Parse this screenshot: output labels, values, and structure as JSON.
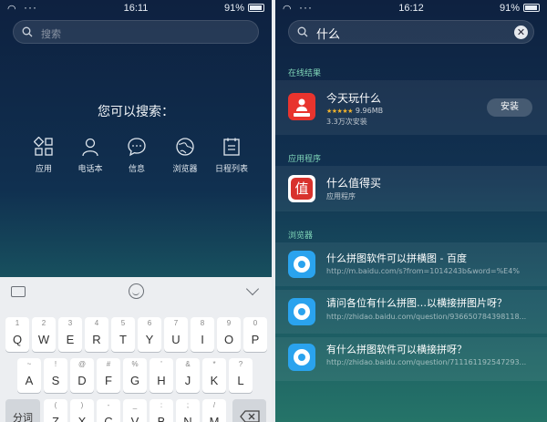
{
  "left": {
    "status": {
      "time": "16:11",
      "battery": "91%"
    },
    "search": {
      "placeholder": "搜索"
    },
    "hint": "您可以搜索：",
    "categories": [
      {
        "label": "应用",
        "icon": "apps-grid-icon"
      },
      {
        "label": "电话本",
        "icon": "contacts-person-icon"
      },
      {
        "label": "信息",
        "icon": "message-bubble-icon"
      },
      {
        "label": "浏览器",
        "icon": "browser-globe-icon"
      },
      {
        "label": "日程列表",
        "icon": "calendar-list-icon"
      }
    ],
    "keyboard": {
      "row1": [
        {
          "num": "1",
          "ch": "Q"
        },
        {
          "num": "2",
          "ch": "W"
        },
        {
          "num": "3",
          "ch": "E"
        },
        {
          "num": "4",
          "ch": "R"
        },
        {
          "num": "5",
          "ch": "T"
        },
        {
          "num": "6",
          "ch": "Y"
        },
        {
          "num": "7",
          "ch": "U"
        },
        {
          "num": "8",
          "ch": "I"
        },
        {
          "num": "9",
          "ch": "O"
        },
        {
          "num": "0",
          "ch": "P"
        }
      ],
      "row2": [
        {
          "num": "~",
          "ch": "A"
        },
        {
          "num": "!",
          "ch": "S"
        },
        {
          "num": "@",
          "ch": "D"
        },
        {
          "num": "#",
          "ch": "F"
        },
        {
          "num": "%",
          "ch": "G"
        },
        {
          "num": "'",
          "ch": "H"
        },
        {
          "num": "&",
          "ch": "J"
        },
        {
          "num": "*",
          "ch": "K"
        },
        {
          "num": "?",
          "ch": "L"
        }
      ],
      "row3": [
        {
          "num": "",
          "ch": "分词"
        },
        {
          "num": "(",
          "ch": "Z"
        },
        {
          "num": ")",
          "ch": "X"
        },
        {
          "num": "-",
          "ch": "C"
        },
        {
          "num": "_",
          "ch": "V"
        },
        {
          "num": ":",
          "ch": "B"
        },
        {
          "num": ";",
          "ch": "N"
        },
        {
          "num": "/",
          "ch": "M"
        }
      ]
    }
  },
  "right": {
    "status": {
      "time": "16:12",
      "battery": "91%"
    },
    "search": {
      "query": "什么"
    },
    "sections": {
      "online": "在线结果",
      "apps": "应用程序",
      "browser": "浏览器"
    },
    "online_result": {
      "title": "今天玩什么",
      "rating_stars": "★★★★★",
      "size": "9.96MB",
      "installs": "3.3万次安装",
      "button": "安装",
      "icon_color": "#e8342e"
    },
    "app_result": {
      "title": "什么值得买",
      "subtitle": "应用程序",
      "icon_color": "#d8322d",
      "icon_char": "值"
    },
    "browser_results": [
      {
        "title": "什么拼图软件可以拼横图 - 百度",
        "url": "http://m.baidu.com/s?from=1014243b&word=%E4%"
      },
      {
        "title": "请问各位有什么拼图…以横接拼图片呀？",
        "url": "http://zhidao.baidu.com/question/936650784398118..."
      },
      {
        "title": "有什么拼图软件可以横接拼呀？",
        "url": "http://zhidao.baidu.com/question/711161192547293..."
      }
    ]
  }
}
